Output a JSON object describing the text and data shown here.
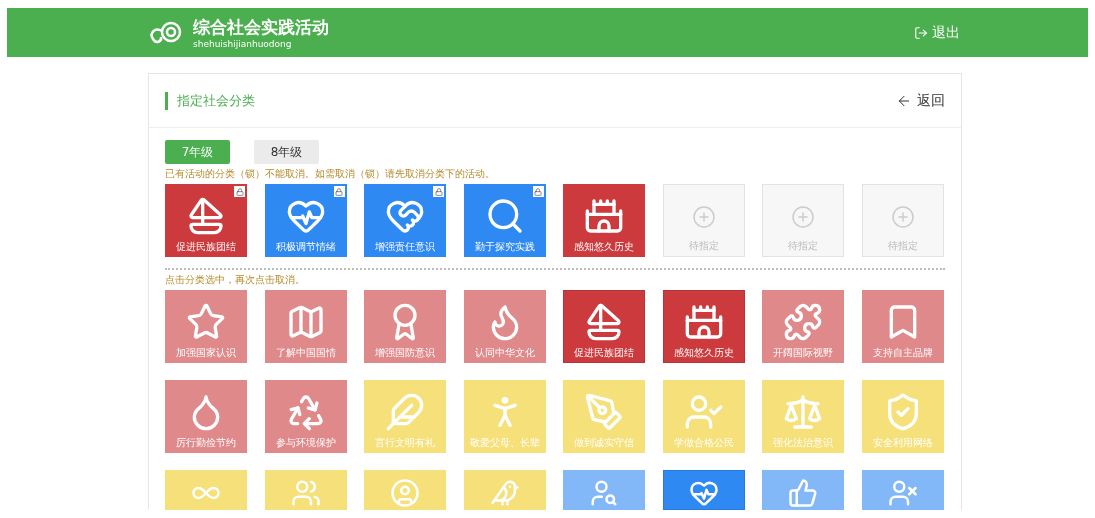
{
  "header": {
    "title": "综合社会实践活动",
    "subtitle": "shehuishijianhuodong",
    "logout": "退出"
  },
  "panel": {
    "title": "指定社会分类",
    "back": "返回"
  },
  "tabs": [
    {
      "label": "7年级",
      "selected": true
    },
    {
      "label": "8年级",
      "selected": false
    }
  ],
  "assigned_note": "已有活动的分类（锁）不能取消。如需取消（锁）请先取消分类下的活动。",
  "assigned": [
    {
      "kind": "category",
      "label": "促进民族团结",
      "locked": true,
      "color": "#cc3a3d"
    },
    {
      "kind": "category",
      "label": "积极调节情绪",
      "locked": true,
      "color": "#2e89f3"
    },
    {
      "kind": "category",
      "label": "增强责任意识",
      "locked": true,
      "color": "#2e89f3"
    },
    {
      "kind": "category",
      "label": "勤于探究实践",
      "locked": true,
      "color": "#2e89f3"
    },
    {
      "kind": "category",
      "label": "感知悠久历史",
      "locked": false,
      "color": "#cc3a3d"
    },
    {
      "kind": "empty",
      "label": "待指定"
    },
    {
      "kind": "empty",
      "label": "待指定"
    },
    {
      "kind": "empty",
      "label": "待指定"
    }
  ],
  "pick_note": "点击分类选中，再次点击取消。",
  "categories": [
    {
      "label": "加强国家认识",
      "selected": false,
      "color": "#e0898b"
    },
    {
      "label": "了解中国国情",
      "selected": false,
      "color": "#e0898b"
    },
    {
      "label": "增强国防意识",
      "selected": false,
      "color": "#e0898b"
    },
    {
      "label": "认同中华文化",
      "selected": false,
      "color": "#e0898b"
    },
    {
      "label": "促进民族团结",
      "selected": true,
      "color": "#cc3a3d"
    },
    {
      "label": "感知悠久历史",
      "selected": true,
      "color": "#cc3a3d"
    },
    {
      "label": "开阔国际视野",
      "selected": false,
      "color": "#e0898b"
    },
    {
      "label": "支持自主品牌",
      "selected": false,
      "color": "#e0898b"
    },
    {
      "label": "厉行勤俭节约",
      "selected": false,
      "color": "#e0898b"
    },
    {
      "label": "参与环境保护",
      "selected": false,
      "color": "#e0898b"
    },
    {
      "label": "言行文明有礼",
      "selected": false,
      "color": "#f6e07a"
    },
    {
      "label": "敬爱父母、长辈",
      "selected": false,
      "color": "#f6e07a"
    },
    {
      "label": "做到诚实守信",
      "selected": false,
      "color": "#f6e07a"
    },
    {
      "label": "学做合格公民",
      "selected": false,
      "color": "#f6e07a"
    },
    {
      "label": "强化法治意识",
      "selected": false,
      "color": "#f6e07a"
    },
    {
      "label": "安全利用网络",
      "selected": false,
      "color": "#f6e07a"
    },
    {
      "selected": false,
      "color": "#f6e07a"
    },
    {
      "selected": false,
      "color": "#f6e07a"
    },
    {
      "selected": false,
      "color": "#f6e07a"
    },
    {
      "selected": false,
      "color": "#f6e07a"
    },
    {
      "selected": false,
      "color": "#82b8f8"
    },
    {
      "selected": true,
      "color": "#2e89f3"
    },
    {
      "selected": false,
      "color": "#82b8f8"
    },
    {
      "selected": false,
      "color": "#82b8f8"
    }
  ]
}
